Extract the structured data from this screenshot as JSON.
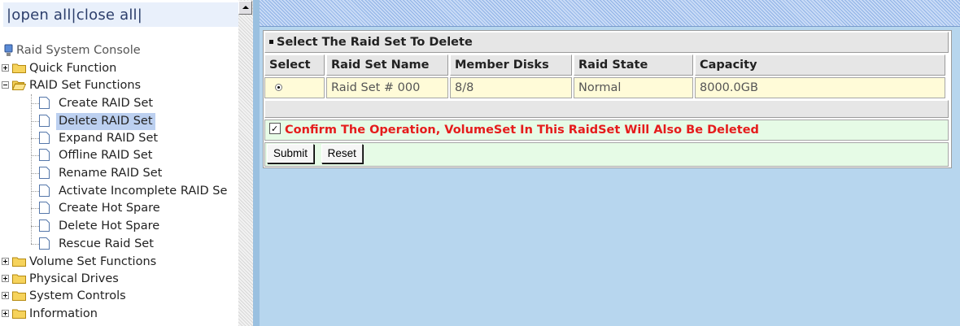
{
  "toplinks": "|open all|close all|",
  "tree": {
    "root": "Raid System Console",
    "quick": "Quick Function",
    "raidset": "RAID Set Functions",
    "items": [
      "Create RAID Set",
      "Delete RAID Set",
      "Expand RAID Set",
      "Offline RAID Set",
      "Rename RAID Set",
      "Activate Incomplete RAID Se",
      "Create Hot Spare",
      "Delete Hot Spare",
      "Rescue Raid Set"
    ],
    "volume": "Volume Set Functions",
    "physical": "Physical Drives",
    "system": "System Controls",
    "info": "Information"
  },
  "panel": {
    "title": "Select The Raid Set To Delete",
    "headers": [
      "Select",
      "Raid Set Name",
      "Member Disks",
      "Raid State",
      "Capacity"
    ],
    "row": [
      "Raid Set # 000",
      "8/8",
      "Normal",
      "8000.0GB"
    ],
    "confirm": "Confirm The Operation, VolumeSet In This RaidSet Will Also Be Deleted",
    "submit": "Submit",
    "reset": "Reset"
  }
}
